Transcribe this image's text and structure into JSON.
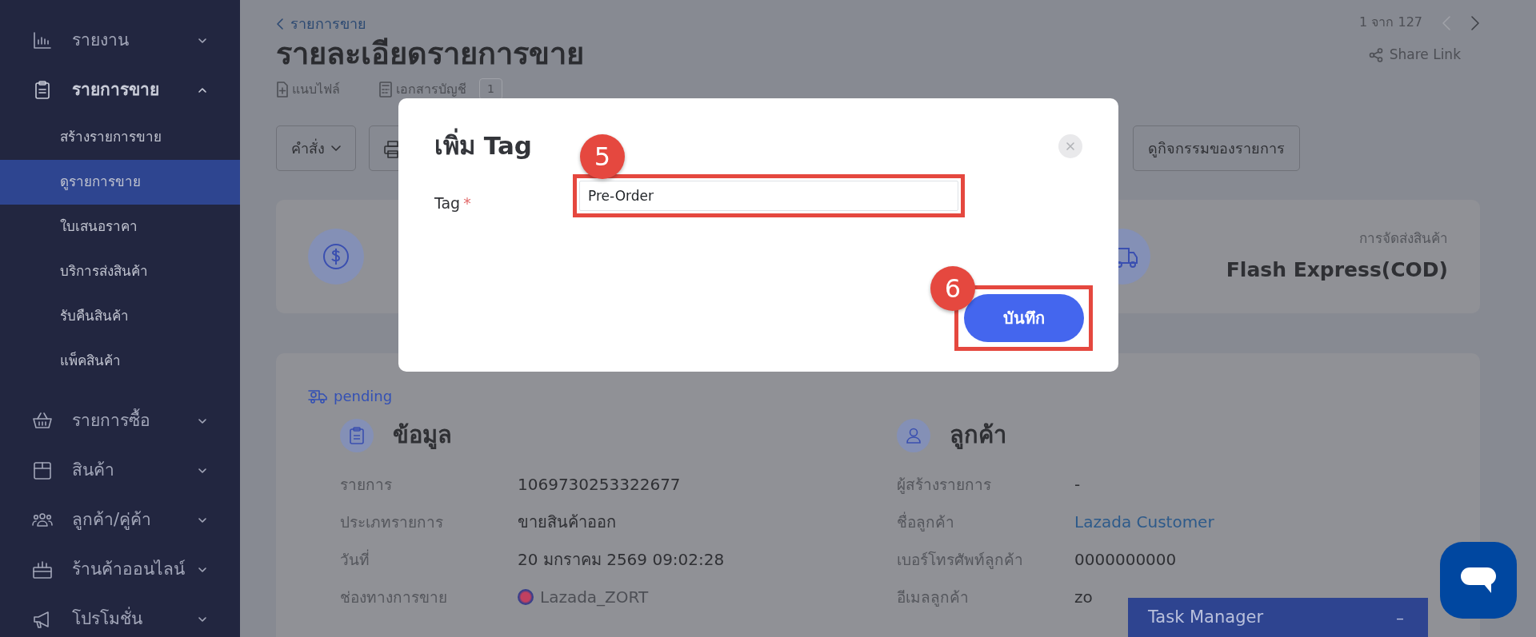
{
  "sidebar": {
    "items": [
      {
        "label": "รายงาน",
        "expanded": false,
        "selected": false
      },
      {
        "label": "รายการขาย",
        "expanded": true,
        "selected": true,
        "children": [
          {
            "label": "สร้างรายการขาย",
            "selected": false
          },
          {
            "label": "ดูรายการขาย",
            "selected": true
          },
          {
            "label": "ใบเสนอราคา",
            "selected": false
          },
          {
            "label": "บริการส่งสินค้า",
            "selected": false
          },
          {
            "label": "รับคืนสินค้า",
            "selected": false
          },
          {
            "label": "แพ็คสินค้า",
            "selected": false
          }
        ]
      },
      {
        "label": "รายการซื้อ",
        "expanded": false,
        "selected": false
      },
      {
        "label": "สินค้า",
        "expanded": false,
        "selected": false
      },
      {
        "label": "ลูกค้า/คู่ค้า",
        "expanded": false,
        "selected": false
      },
      {
        "label": "ร้านค้าออนไลน์",
        "expanded": false,
        "selected": false
      },
      {
        "label": "โปรโมชั่น",
        "expanded": false,
        "selected": false
      }
    ]
  },
  "header": {
    "back_link": "รายการขาย",
    "title": "รายละเอียดรายการขาย",
    "pager": "1 จาก 127",
    "share_link": "Share Link",
    "attach_file": "แนบไฟล์",
    "accounting_doc": "เอกสารบัญชี",
    "accounting_count": "1"
  },
  "actions": {
    "command": "คำสั่ง",
    "activity": "ดูกิจกรรมของรายการ"
  },
  "summary": {
    "shipping_label": "การจัดส่งสินค้า",
    "shipping_value": "Flash Express(COD)"
  },
  "details": {
    "status": "pending",
    "info": {
      "title": "ข้อมูล",
      "rows": [
        {
          "label": "รายการ",
          "value": "1069730253322677",
          "kind": "text"
        },
        {
          "label": "ประเภทรายการ",
          "value": "ขายสินค้าออก",
          "kind": "text"
        },
        {
          "label": "วันที่",
          "value": "20 มกราคม 2569 09:02:28",
          "kind": "text"
        },
        {
          "label": "ช่องทางการขาย",
          "value": "Lazada_ZORT",
          "kind": "channel"
        }
      ]
    },
    "customer": {
      "title": "ลูกค้า",
      "rows": [
        {
          "label": "ผู้สร้างรายการ",
          "value": "-",
          "kind": "text"
        },
        {
          "label": "ชื่อลูกค้า",
          "value": "Lazada Customer",
          "kind": "link"
        },
        {
          "label": "เบอร์โทรศัพท์ลูกค้า",
          "value": "0000000000",
          "kind": "text"
        },
        {
          "label": "อีเมลลูกค้า",
          "value": "zo",
          "kind": "text"
        }
      ]
    }
  },
  "modal": {
    "title": "เพิ่ม Tag",
    "field_label": "Tag",
    "required_mark": "*",
    "value": "Pre-Order",
    "save": "บันทึก"
  },
  "annotations": [
    {
      "number": "5"
    },
    {
      "number": "6"
    }
  ],
  "task_manager": {
    "title": "Task Manager",
    "toggle": "–"
  }
}
